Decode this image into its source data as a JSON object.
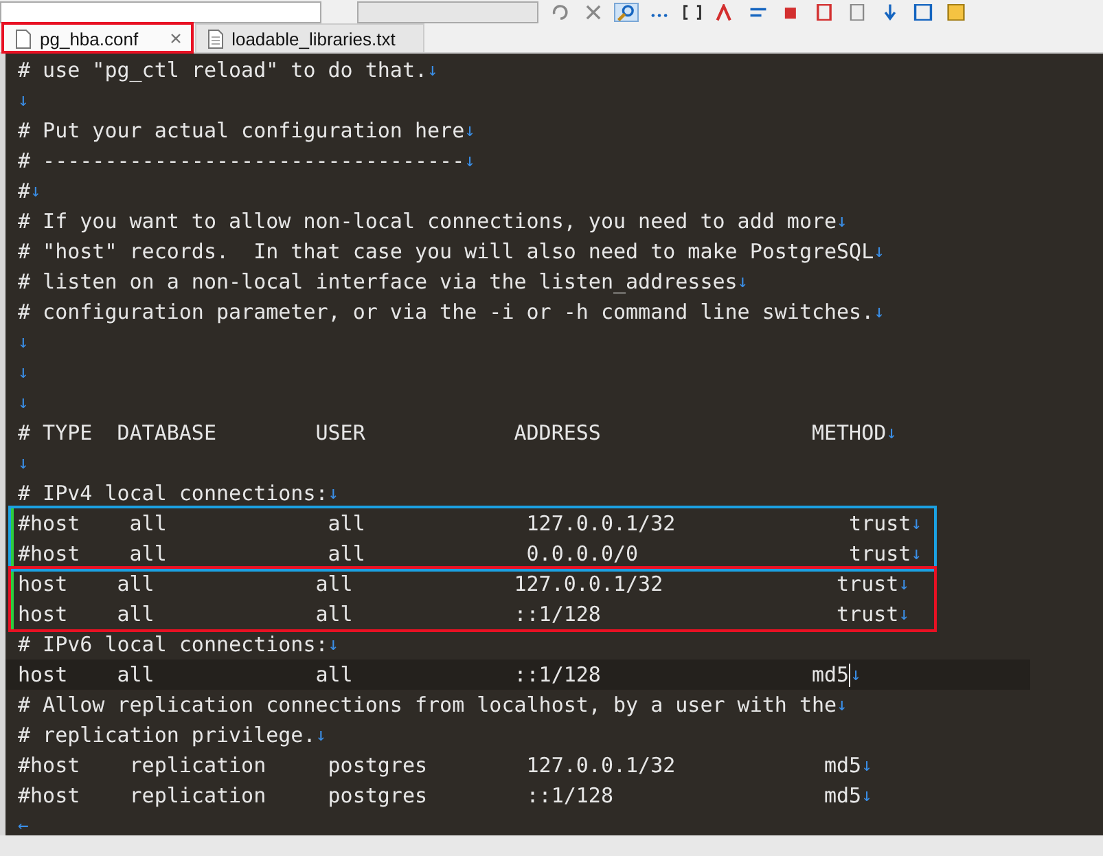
{
  "tabs": [
    {
      "label": "pg_hba.conf",
      "selected": true,
      "closable": true,
      "outlined": true
    },
    {
      "label": "loadable_libraries.txt",
      "selected": false,
      "closable": false,
      "outlined": false
    }
  ],
  "editor": {
    "blocks": [
      {
        "lines": [
          {
            "text": "# use \"pg_ctl reload\" to do that.",
            "eol": "↓"
          },
          {
            "eol": "↓"
          },
          {
            "text": "# Put your actual configuration here",
            "eol": "↓"
          },
          {
            "text": "# ----------------------------------",
            "eol": "↓"
          },
          {
            "text": "#",
            "eol": "↓"
          },
          {
            "text": "# If you want to allow non-local connections, you need to add more",
            "eol": "↓"
          },
          {
            "text": "# \"host\" records.  In that case you will also need to make PostgreSQL",
            "eol": "↓"
          },
          {
            "text": "# listen on a non-local interface via the listen_addresses",
            "eol": "↓"
          },
          {
            "text": "# configuration parameter, or via the -i or -h command line switches.",
            "eol": "↓"
          },
          {
            "eol": "↓"
          },
          {
            "eol": "↓"
          },
          {
            "eol": "↓"
          },
          {
            "text": "# TYPE  DATABASE        USER            ADDRESS                 METHOD",
            "eol": "↓"
          },
          {
            "eol": "↓"
          },
          {
            "text": "# IPv4 local connections:",
            "eol": "↓"
          }
        ]
      },
      {
        "color": "#1ba1e2",
        "lines": [
          {
            "text": "#host    all             all             127.0.0.1/32              trust",
            "eol": "↓",
            "modified": true
          },
          {
            "text": "#host    all             all             0.0.0.0/0                 trust",
            "eol": "↓",
            "modified": true
          }
        ]
      },
      {
        "color": "#e81123",
        "lines": [
          {
            "text": "host    all             all             127.0.0.1/32              trust",
            "eol": "↓",
            "modified": true
          },
          {
            "text": "host    all             all             ::1/128                   trust",
            "eol": "↓",
            "modified": true
          }
        ]
      },
      {
        "lines": [
          {
            "text": "# IPv6 local connections:",
            "eol": "↓"
          },
          {
            "text": "host    all             all             ::1/128                 md5",
            "eol": "↓",
            "current": true
          },
          {
            "text": "# Allow replication connections from localhost, by a user with the",
            "eol": "↓"
          },
          {
            "text": "# replication privilege.",
            "eol": "↓"
          },
          {
            "text": "#host    replication     postgres        127.0.0.1/32            md5",
            "eol": "↓"
          },
          {
            "text": "#host    replication     postgres        ::1/128                 md5",
            "eol": "↓"
          },
          {
            "eol": "←"
          }
        ]
      }
    ]
  }
}
